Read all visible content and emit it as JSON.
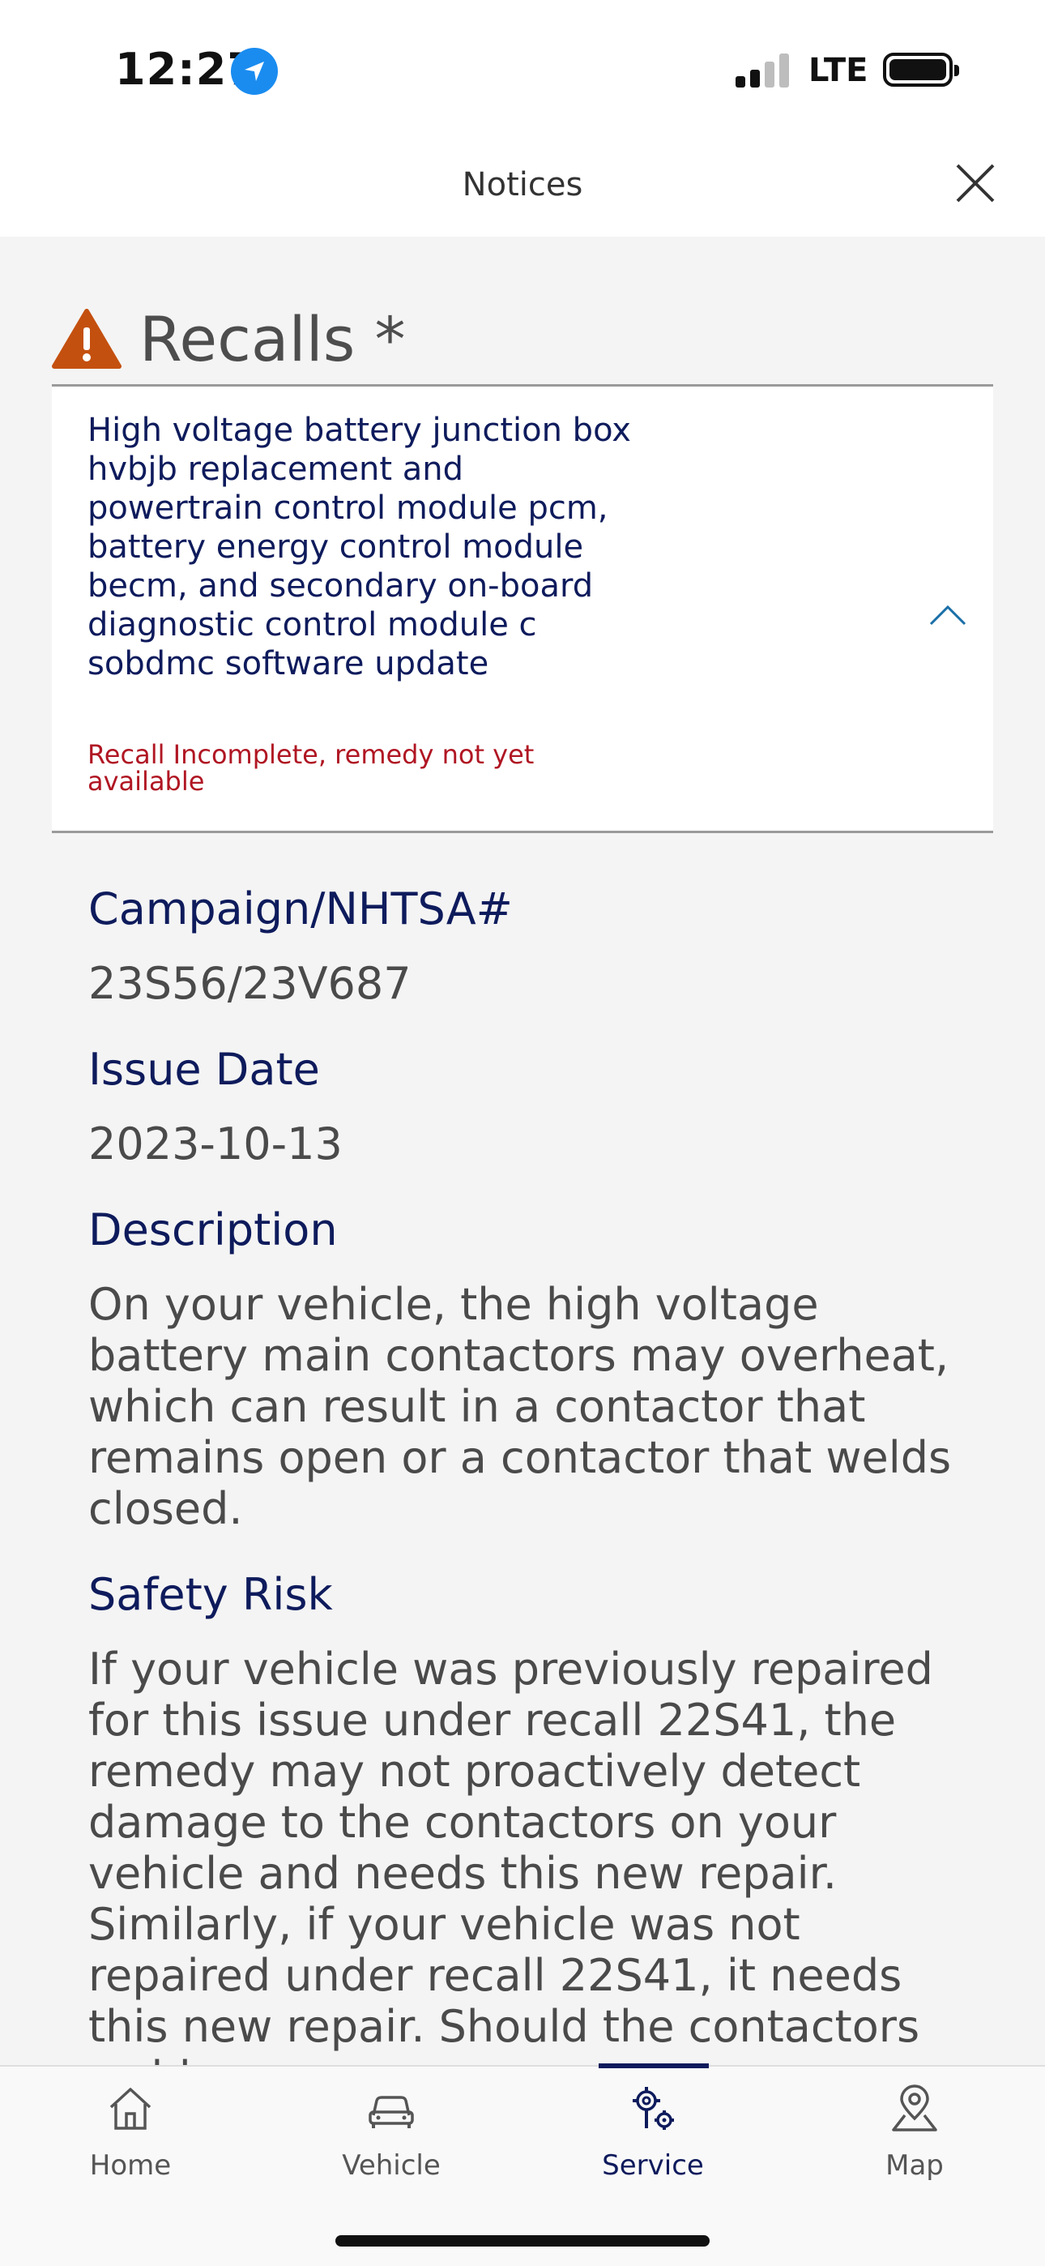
{
  "status_bar": {
    "time": "12:27",
    "network": "LTE"
  },
  "header": {
    "title": "Notices"
  },
  "recalls": {
    "heading": "Recalls *",
    "card": {
      "title": "High voltage battery junction box hvbjb replacement and powertrain control module pcm, battery energy control module becm, and secondary on-board diagnostic control module c sobdmc software update",
      "status": "Recall Incomplete, remedy not yet available"
    }
  },
  "details": {
    "campaign_label": "Campaign/NHTSA#",
    "campaign_value": "23S56/23V687",
    "issue_date_label": "Issue Date",
    "issue_date_value": "2023-10-13",
    "description_label": "Description",
    "description_text": "On your vehicle, the high voltage battery main contactors may overheat, which can result in a contactor that remains open or a contactor that welds closed.",
    "safety_risk_label": "Safety Risk",
    "safety_risk_text": "If your vehicle was previously repaired for this issue under recall 22S41, the remedy may not proactively detect damage to the contactors on your vehicle and needs this new repair. Similarly, if your vehicle was not repaired under recall 22S41, it needs this new repair. Should the contactors weld"
  },
  "nav": {
    "items": [
      {
        "label": "Home",
        "icon": "home-icon"
      },
      {
        "label": "Vehicle",
        "icon": "car-icon"
      },
      {
        "label": "Service",
        "icon": "service-gears-icon"
      },
      {
        "label": "Map",
        "icon": "map-pin-icon"
      }
    ],
    "active": "Service"
  },
  "colors": {
    "primary_navy": "#0e1b5c",
    "recall_red": "#b01623",
    "warning_orange": "#c4500f",
    "location_blue": "#1a8cf0"
  }
}
